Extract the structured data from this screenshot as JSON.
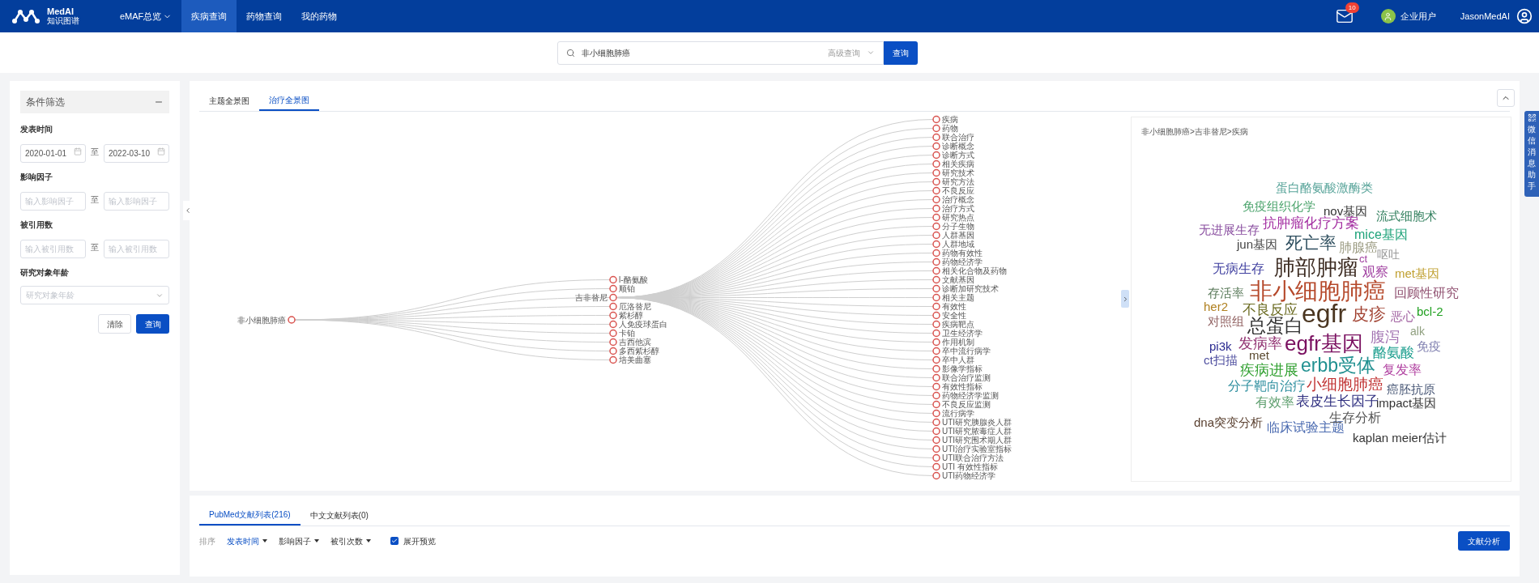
{
  "header": {
    "logo_title": "MedAI",
    "logo_subtitle": "知识图谱",
    "nav": [
      {
        "label": "eMAF总览",
        "dropdown": true,
        "selected": false
      },
      {
        "label": "疾病查询",
        "dropdown": false,
        "selected": true
      },
      {
        "label": "药物查询",
        "dropdown": false,
        "selected": false
      },
      {
        "label": "我的药物",
        "dropdown": false,
        "selected": false
      }
    ],
    "mail_badge": "10",
    "org_label": "企业用户",
    "username": "JasonMedAI"
  },
  "search": {
    "value": "非小细胞肺癌",
    "advanced_label": "高级查询",
    "button": "查询"
  },
  "filters": {
    "title": "条件筛选",
    "ranges": [
      {
        "label": "发表时间",
        "kind": "date",
        "from": {
          "value": "2020-01-01"
        },
        "separator": "至",
        "to": {
          "value": "2022-03-10"
        }
      },
      {
        "label": "影响因子",
        "kind": "number",
        "from": {
          "placeholder": "输入影响因子"
        },
        "separator": "至",
        "to": {
          "placeholder": "输入影响因子"
        }
      },
      {
        "label": "被引用数",
        "kind": "number",
        "from": {
          "placeholder": "输入被引用数"
        },
        "separator": "至",
        "to": {
          "placeholder": "输入被引用数"
        }
      }
    ],
    "age": {
      "label": "研究对象年龄",
      "placeholder": "研究对象年龄"
    },
    "buttons": [
      {
        "label": "清除",
        "kind": "secondary"
      },
      {
        "label": "查询",
        "kind": "primary"
      }
    ]
  },
  "views": {
    "tabs": [
      {
        "label": "主题全景图",
        "selected": false
      },
      {
        "label": "治疗全景图",
        "selected": true
      }
    ],
    "tree": {
      "label": "非小细胞肺癌",
      "children": [
        {
          "label": "l-酪氨酸"
        },
        {
          "label": "顺铂"
        },
        {
          "label": "吉非替尼",
          "children": [
            {
              "label": "疾病"
            },
            {
              "label": "药物"
            },
            {
              "label": "联合治疗"
            },
            {
              "label": "诊断概念"
            },
            {
              "label": "诊断方式"
            },
            {
              "label": "相关疾病"
            },
            {
              "label": "研究技术"
            },
            {
              "label": "研究方法"
            },
            {
              "label": "不良反应"
            },
            {
              "label": "治疗概念"
            },
            {
              "label": "治疗方式"
            },
            {
              "label": "研究热点"
            },
            {
              "label": "分子生物"
            },
            {
              "label": "人群基因"
            },
            {
              "label": "人群地域"
            },
            {
              "label": "药物有效性"
            },
            {
              "label": "药物经济学"
            },
            {
              "label": "相关化合物及药物"
            },
            {
              "label": "文献基因"
            },
            {
              "label": "诊断加研究技术"
            },
            {
              "label": "相关主题"
            },
            {
              "label": "有效性"
            },
            {
              "label": "安全性"
            },
            {
              "label": "疾病靶点"
            },
            {
              "label": "卫生经济学"
            },
            {
              "label": "作用机制"
            },
            {
              "label": "卒中流行病学"
            },
            {
              "label": "卒中人群"
            },
            {
              "label": "影像学指标"
            },
            {
              "label": "联合治疗监测"
            },
            {
              "label": "有效性指标"
            },
            {
              "label": "药物经济学监测"
            },
            {
              "label": "不良反应监测"
            },
            {
              "label": "流行病学"
            },
            {
              "label": "UTI研究胰腺炎人群"
            },
            {
              "label": "UTI研究脓毒症人群"
            },
            {
              "label": "UTI研究围术期人群"
            },
            {
              "label": "UTI治疗实验室指标"
            },
            {
              "label": "UTI联合治疗方法"
            },
            {
              "label": "UTI 有效性指标"
            },
            {
              "label": "UTI药物经济学"
            }
          ]
        },
        {
          "label": "厄洛替尼"
        },
        {
          "label": "紫杉醇"
        },
        {
          "label": "人免疫球蛋白"
        },
        {
          "label": "卡铂"
        },
        {
          "label": "吉西他滨"
        },
        {
          "label": "多西紫杉醇"
        },
        {
          "label": "培美曲塞"
        }
      ]
    },
    "cloud": {
      "breadcrumb": "非小细胞肺癌>吉非替尼>疾病",
      "words": [
        {
          "text": "蛋白酪氨酸激酶类",
          "color": "#5aa59b"
        },
        {
          "text": "免疫组织化学",
          "color": "#4aa36b"
        },
        {
          "text": "nov基因",
          "color": "#333333"
        },
        {
          "text": "流式细胞术",
          "color": "#2e7d5b"
        },
        {
          "text": "无进展生存",
          "color": "#8a4fa0"
        },
        {
          "text": "抗肿瘤化疗方案",
          "color": "#a22ba0"
        },
        {
          "text": "mice基因",
          "color": "#1fa37a"
        },
        {
          "text": "jun基因",
          "color": "#444444"
        },
        {
          "text": "死亡率",
          "color": "#2f4f5f"
        },
        {
          "text": "肺腺癌",
          "color": "#9a9a80"
        },
        {
          "text": "呕吐",
          "color": "#999999"
        },
        {
          "text": "无病生存",
          "color": "#4040a0"
        },
        {
          "text": "肺部肿瘤",
          "color": "#3b2a20"
        },
        {
          "text": "ct",
          "color": "#a040a0"
        },
        {
          "text": "观察",
          "color": "#a040a0"
        },
        {
          "text": "met基因",
          "color": "#c0a030"
        },
        {
          "text": "存活率",
          "color": "#5a7a5a"
        },
        {
          "text": "非小细胞肺癌",
          "color": "#b5482a"
        },
        {
          "text": "回顾性研究",
          "color": "#905070"
        },
        {
          "text": "her2",
          "color": "#b08020"
        },
        {
          "text": "不良反应",
          "color": "#6a6a20"
        },
        {
          "text": "egfr",
          "color": "#4a3520"
        },
        {
          "text": "皮疹",
          "color": "#a04030"
        },
        {
          "text": "恶心",
          "color": "#a060a0"
        },
        {
          "text": "bcl-2",
          "color": "#20a020"
        },
        {
          "text": "对照组",
          "color": "#906060"
        },
        {
          "text": "总蛋白",
          "color": "#333333"
        },
        {
          "text": "alk",
          "color": "#90a080"
        },
        {
          "text": "pi3k",
          "color": "#2a2a90"
        },
        {
          "text": "发病率",
          "color": "#903070"
        },
        {
          "text": "egfr基因",
          "color": "#7a1060"
        },
        {
          "text": "腹泻",
          "color": "#a070b0"
        },
        {
          "text": "免疫",
          "color": "#8080b0"
        },
        {
          "text": "ct扫描",
          "color": "#5050a0"
        },
        {
          "text": "met",
          "color": "#5a4a30"
        },
        {
          "text": "酪氨酸",
          "color": "#20a090"
        },
        {
          "text": "疾病进展",
          "color": "#30a030"
        },
        {
          "text": "erbb受体",
          "color": "#209090"
        },
        {
          "text": "复发率",
          "color": "#b040a0"
        },
        {
          "text": "分子靶向治疗",
          "color": "#3090a0"
        },
        {
          "text": "小细胞肺癌",
          "color": "#c03030"
        },
        {
          "text": "癌胚抗原",
          "color": "#405070"
        },
        {
          "text": "有效率",
          "color": "#60a070"
        },
        {
          "text": "表皮生长因子",
          "color": "#303080"
        },
        {
          "text": "impact基因",
          "color": "#333333"
        },
        {
          "text": "dna突变分析",
          "color": "#5a4030"
        },
        {
          "text": "临床试验主题",
          "color": "#4a6ab0"
        },
        {
          "text": "生存分析",
          "color": "#555555"
        },
        {
          "text": "kaplan meier估计",
          "color": "#333333"
        }
      ]
    }
  },
  "side_tab": {
    "label": "微信消息助手"
  },
  "literature": {
    "tabs": [
      {
        "label": "PubMed文献列表(216)",
        "selected": true
      },
      {
        "label": "中文文献列表(0)",
        "selected": false
      }
    ],
    "sort_label": "排序",
    "sort_options": [
      {
        "label": "发表时间",
        "selected": true
      },
      {
        "label": "影响因子",
        "selected": false
      },
      {
        "label": "被引次数",
        "selected": false
      }
    ],
    "preview": {
      "label": "展开预览",
      "checked": true
    },
    "analyze_button": "文献分析"
  }
}
